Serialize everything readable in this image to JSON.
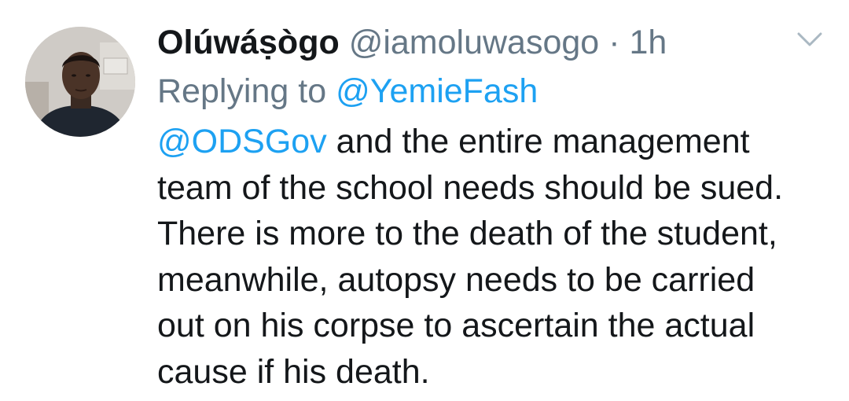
{
  "tweet": {
    "display_name": "Olúwáṣògo",
    "handle": "@iamoluwasogo",
    "separator": "·",
    "time": "1h",
    "menu_icon": "chevron-down-icon",
    "avatar_icon": "user-avatar",
    "reply": {
      "prefix": "Replying to ",
      "mention": "@YemieFash"
    },
    "body": {
      "mention": "@ODSGov",
      "line1_rest": " and the entire management",
      "line2": "team of the school needs should be sued.",
      "line3": "There is more to the death of the student,",
      "line4": "meanwhile, autopsy needs to be carried",
      "line5": "out on his corpse to ascertain the actual",
      "line6": "cause if his death."
    }
  },
  "colors": {
    "text": "#14171a",
    "secondary": "#657786",
    "link": "#1da1f2",
    "background": "#ffffff"
  }
}
